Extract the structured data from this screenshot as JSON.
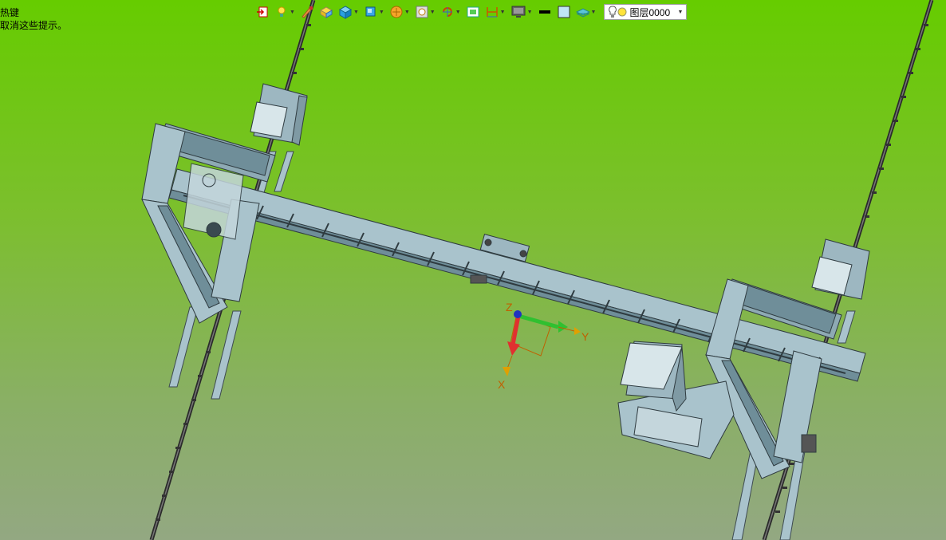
{
  "hint": {
    "line1": "热键",
    "line2": "取消这些提示。"
  },
  "toolbar": {
    "icons": [
      "import-icon",
      "light-icon",
      "paint-icon",
      "box-icon",
      "cube-icon",
      "view-cube-icon",
      "render-icon",
      "zoom-icon",
      "rotate-icon",
      "screen-icon",
      "dimension-icon",
      "monitor-icon",
      "line-icon",
      "color-square-icon",
      "layer-stack-icon"
    ],
    "layer": {
      "label": "图层0000",
      "light": "lightbulb-icon",
      "status": "yellow"
    }
  },
  "axis": {
    "x": "X",
    "y": "Y",
    "z": "Z"
  },
  "colors": {
    "frame": "#a9c3cc",
    "frame_dark": "#6f8e99",
    "line": "#2f3b40",
    "x_axis": "#e03030",
    "y_axis": "#30c030",
    "z_axis": "#2030c0",
    "axis_label": "#c06000"
  }
}
